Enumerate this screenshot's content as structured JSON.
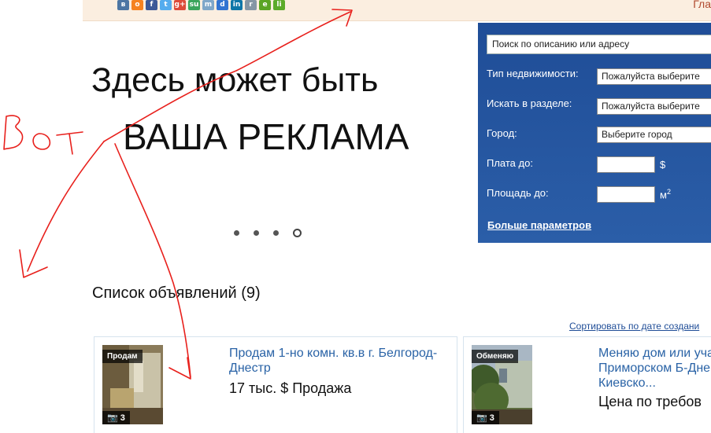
{
  "header": {
    "share_icons": [
      {
        "name": "vkontakte-icon",
        "glyph": "в",
        "color": "#4c75a3"
      },
      {
        "name": "odnoklassniki-icon",
        "glyph": "о",
        "color": "#f58220"
      },
      {
        "name": "facebook-icon",
        "glyph": "f",
        "color": "#3b5998"
      },
      {
        "name": "twitter-icon",
        "glyph": "t",
        "color": "#55acee"
      },
      {
        "name": "google-plus-icon",
        "glyph": "g+",
        "color": "#dd4b39"
      },
      {
        "name": "stumbleupon-icon",
        "glyph": "su",
        "color": "#3aa55d"
      },
      {
        "name": "myspace-icon",
        "glyph": "m",
        "color": "#7fa7c9"
      },
      {
        "name": "delicious-icon",
        "glyph": "d",
        "color": "#3274d1"
      },
      {
        "name": "linkedin-icon",
        "glyph": "in",
        "color": "#0e76a8"
      },
      {
        "name": "reddit-icon",
        "glyph": "r",
        "color": "#8596a5"
      },
      {
        "name": "evernote-icon",
        "glyph": "e",
        "color": "#5ba525"
      },
      {
        "name": "liveinternet-icon",
        "glyph": "li",
        "color": "#5cab2a"
      }
    ],
    "nav_link": "Гла"
  },
  "banner": {
    "line1": "Здесь может быть",
    "line2": "ВАША РЕКЛАМА",
    "slides": [
      false,
      false,
      false,
      true
    ]
  },
  "search": {
    "placeholder": "Поиск по описанию или адресу",
    "property_type_label": "Тип недвижимости:",
    "property_type_value": "Пожалуйста выберите",
    "section_label": "Искать в разделе:",
    "section_value": "Пожалуйста выберите",
    "city_label": "Город:",
    "city_value": "Выберите город",
    "price_label": "Плата до:",
    "price_unit": "$",
    "area_label": "Площадь до:",
    "area_unit": "м",
    "area_unit_sup": "2",
    "more_params": "Больше параметров"
  },
  "listings": {
    "heading": "Список объявлений (9)",
    "sort_link": "Сортировать по дате создани",
    "items": [
      {
        "badge": "Продам",
        "photos": "3",
        "title": "Продам 1-но комн. кв.в г. Белгород-Днестр",
        "price": "17 тыс. $ Продажа"
      },
      {
        "badge": "Обменяю",
        "photos": "3",
        "title": "Меняю дом или уча Приморском Б-Дне Киевско...",
        "price": "Цена по требов"
      }
    ]
  },
  "annotation": {
    "text": "Вот",
    "color": "#e8201c"
  }
}
